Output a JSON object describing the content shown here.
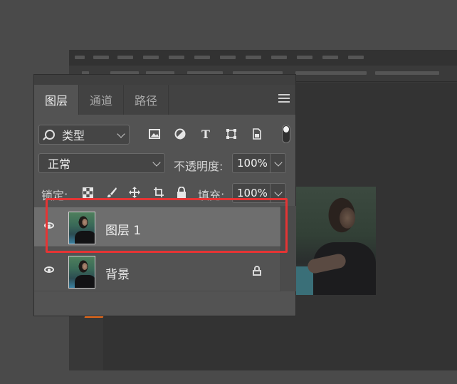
{
  "panel": {
    "tabs": [
      {
        "label": "图层",
        "active": true
      },
      {
        "label": "通道",
        "active": false
      },
      {
        "label": "路径",
        "active": false
      }
    ]
  },
  "filter": {
    "type_label": "类型",
    "icons": [
      "image-filter-icon",
      "adjustment-filter-icon",
      "type-filter-icon",
      "shape-filter-icon",
      "smart-object-filter-icon"
    ],
    "type_glyph": "T"
  },
  "blend": {
    "mode": "正常",
    "opacity_label": "不透明度:",
    "opacity_value": "100%"
  },
  "lock": {
    "label": "锁定:",
    "fill_label": "填充:",
    "fill_value": "100%"
  },
  "layers": [
    {
      "name": "图层 1",
      "visible": true,
      "selected": true,
      "locked": false
    },
    {
      "name": "背景",
      "visible": true,
      "selected": false,
      "locked": true
    }
  ],
  "colors": {
    "highlight": "#e53434",
    "panel_bg": "#535353",
    "selected_row": "#6e6e6e"
  }
}
